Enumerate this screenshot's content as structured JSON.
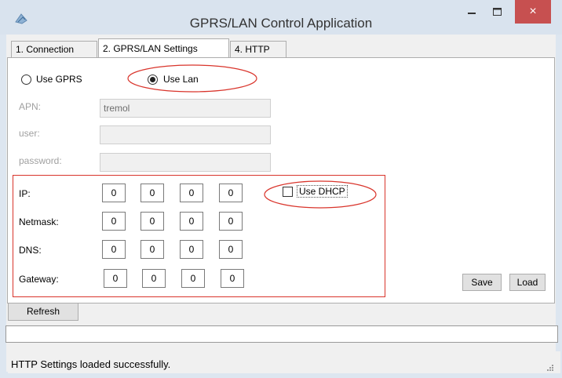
{
  "window": {
    "title": "GPRS/LAN Control Application",
    "close_glyph": "×",
    "icons": [
      "app-icon",
      "minimize-icon",
      "maximize-icon",
      "close-icon",
      "resize-grip-icon"
    ]
  },
  "tabs": [
    {
      "label": "1. Connection",
      "active": false
    },
    {
      "label": "2. GPRS/LAN Settings",
      "active": true
    },
    {
      "label": "4. HTTP",
      "active": false
    }
  ],
  "mode": {
    "gprs_label": "Use GPRS",
    "lan_label": "Use Lan",
    "selected": "lan"
  },
  "gprs_fields": {
    "apn_label": "APN:",
    "apn_value": "tremol",
    "user_label": "user:",
    "user_value": "",
    "password_label": "password:",
    "password_value": ""
  },
  "lan": {
    "dhcp_label": "Use DHCP",
    "dhcp_checked": false,
    "rows": [
      {
        "label": "IP:",
        "octets": [
          "0",
          "0",
          "0",
          "0"
        ]
      },
      {
        "label": "Netmask:",
        "octets": [
          "0",
          "0",
          "0",
          "0"
        ]
      },
      {
        "label": "DNS:",
        "octets": [
          "0",
          "0",
          "0",
          "0"
        ]
      },
      {
        "label": "Gateway:",
        "octets": [
          "0",
          "0",
          "0",
          "0"
        ]
      }
    ]
  },
  "buttons": {
    "save": "Save",
    "load": "Load",
    "refresh": "Refresh"
  },
  "status": {
    "text": "HTTP Settings loaded successfully."
  },
  "colors": {
    "annotation_red": "#d9342b",
    "close_button": "#c75050"
  }
}
